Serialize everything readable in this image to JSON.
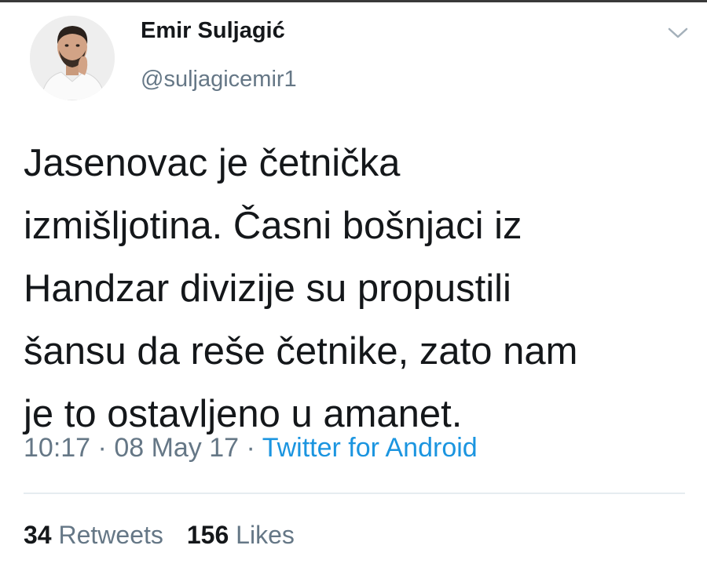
{
  "tweet": {
    "author": {
      "display_name": "Emir Suljagić",
      "handle": "@suljagicemir1"
    },
    "text": "Jasenovac je četnička\nizmišljotina. Časni bošnjaci iz\nHandzar divizije su propustili\nšansu da reše četnike, zato nam\nje to ostavljeno u amanet.",
    "time": "10:17",
    "date": "08 May 17",
    "separator": " · ",
    "source": "Twitter for Android",
    "retweets_count": "34",
    "retweets_label": "Retweets",
    "likes_count": "156",
    "likes_label": "Likes"
  },
  "icons": {
    "menu": "chevron-down-icon",
    "avatar": "profile-photo"
  },
  "colors": {
    "text": "#14171a",
    "secondary": "#657786",
    "link": "#1b95e0",
    "divider": "#e6ecf0"
  }
}
